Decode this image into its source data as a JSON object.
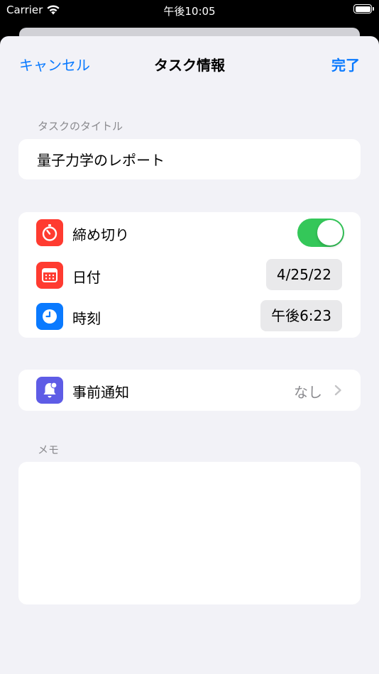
{
  "status_bar": {
    "carrier": "Carrier",
    "time": "午後10:05"
  },
  "nav": {
    "cancel_label": "キャンセル",
    "title": "タスク情報",
    "done_label": "完了"
  },
  "task_title_section": {
    "label": "タスクのタイトル",
    "value": "量子力学のレポート"
  },
  "deadline_section": {
    "deadline": {
      "label": "締め切り",
      "icon": "stopwatch-icon",
      "icon_color": "#ff3b30",
      "enabled": true
    },
    "date": {
      "label": "日付",
      "icon": "calendar-icon",
      "icon_color": "#ff3b30",
      "value": "4/25/22"
    },
    "time": {
      "label": "時刻",
      "icon": "clock-icon",
      "icon_color": "#0a7aff",
      "value": "午後6:23"
    }
  },
  "notification_section": {
    "label": "事前通知",
    "icon": "bell-badge-icon",
    "icon_color": "#5e5ce6",
    "value": "なし"
  },
  "memo_section": {
    "label": "メモ",
    "value": ""
  },
  "colors": {
    "accent": "#0a7aff",
    "toggle_on": "#34c759",
    "background": "#f2f2f7"
  }
}
